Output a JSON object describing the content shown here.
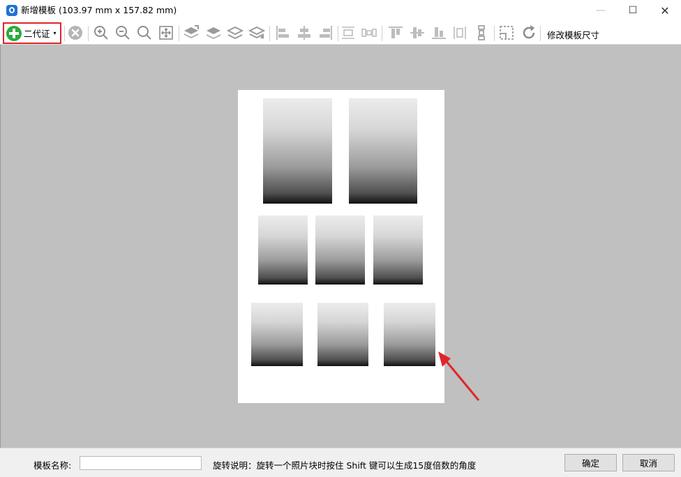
{
  "window": {
    "title": "新增模板 (103.97 mm x 157.82 mm)",
    "minimize_glyph": "—",
    "maximize_glyph": "☐",
    "close_glyph": "✕"
  },
  "toolbar": {
    "type_selector_label": "二代证",
    "type_selector_caret": "▾",
    "resize_template_label": "修改模板尺寸",
    "tools": [
      {
        "name": "delete-icon"
      },
      {
        "name": "zoom-in-icon"
      },
      {
        "name": "zoom-out-icon"
      },
      {
        "name": "zoom-actual-icon"
      },
      {
        "name": "fit-page-icon"
      },
      {
        "name": "bring-to-front-icon"
      },
      {
        "name": "bring-forward-icon"
      },
      {
        "name": "send-backward-icon"
      },
      {
        "name": "send-to-back-icon"
      },
      {
        "name": "align-left-icon"
      },
      {
        "name": "align-center-icon"
      },
      {
        "name": "align-right-icon"
      },
      {
        "name": "distribute-horizontal-icon"
      },
      {
        "name": "center-horizontal-icon"
      },
      {
        "name": "align-top-icon"
      },
      {
        "name": "align-middle-icon"
      },
      {
        "name": "align-bottom-icon"
      },
      {
        "name": "distribute-vertical-icon"
      },
      {
        "name": "center-vertical-icon"
      },
      {
        "name": "crop-icon"
      },
      {
        "name": "rotate-icon"
      }
    ]
  },
  "canvas": {
    "background_color": "#c0c0c0",
    "paper_color": "#ffffff",
    "photo_slot_rows": [
      2,
      3,
      3
    ]
  },
  "footer": {
    "template_name_label": "模板名称:",
    "template_name_value": "",
    "rotate_hint": "旋转说明：旋转一个照片块时按住 Shift 键可以生成15度倍数的角度",
    "confirm_button": "确定",
    "cancel_button": "取消"
  },
  "colors": {
    "highlight_border": "#e0262a",
    "arrow": "#e0262a",
    "add_button": "#2cab3a",
    "app_icon": "#1e73d6"
  }
}
